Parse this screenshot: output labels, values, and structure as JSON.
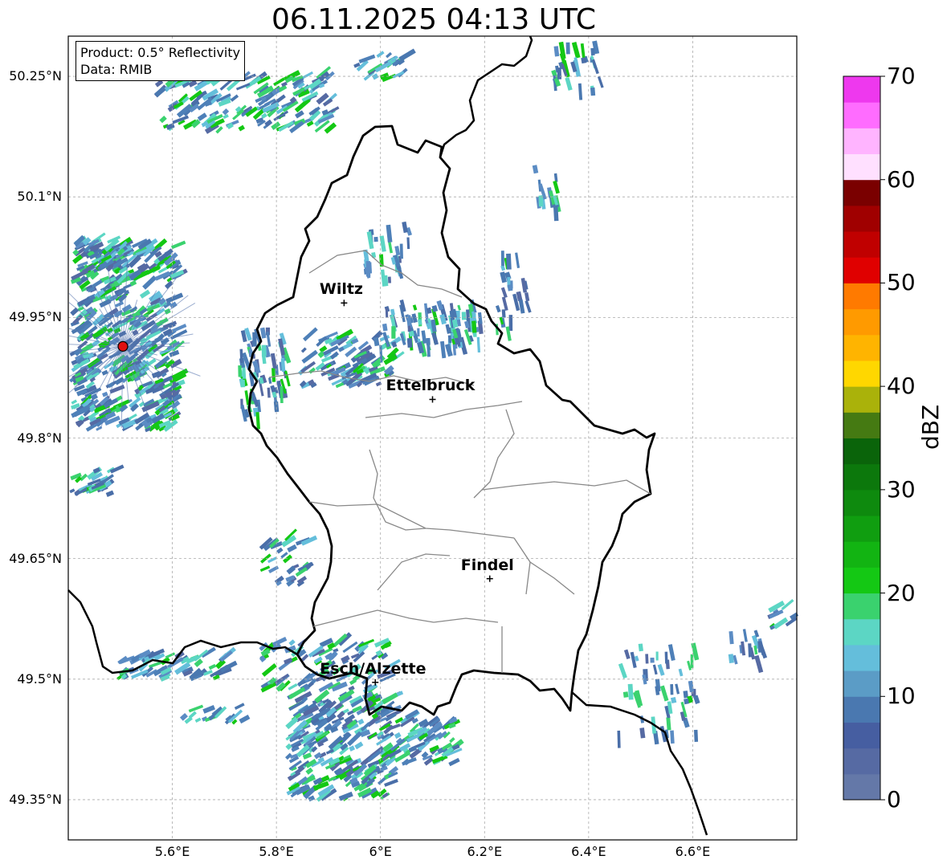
{
  "title": "06.11.2025 04:13 UTC",
  "info": {
    "product": "Product: 0.5° Reflectivity",
    "data": "Data: RMIB"
  },
  "axes": {
    "lat_labels": [
      "50.25°N",
      "50.1°N",
      "49.95°N",
      "49.8°N",
      "49.65°N",
      "49.5°N",
      "49.35°N"
    ],
    "lon_labels": [
      "5.6°E",
      "5.8°E",
      "6°E",
      "6.2°E",
      "6.4°E",
      "6.6°E"
    ],
    "lat_values": [
      50.25,
      50.1,
      49.95,
      49.8,
      49.65,
      49.5,
      49.35
    ],
    "lon_values": [
      5.6,
      5.8,
      6.0,
      6.2,
      6.4,
      6.6
    ],
    "lon_range": [
      5.4,
      6.8
    ],
    "lat_range": [
      49.3,
      50.3
    ]
  },
  "cities": [
    {
      "name": "Wiltz",
      "lon": 5.93,
      "lat": 49.968
    },
    {
      "name": "Ettelbruck",
      "lon": 6.1,
      "lat": 49.848
    },
    {
      "name": "Findel",
      "lon": 6.21,
      "lat": 49.625
    },
    {
      "name": "Esch/Alzette",
      "lon": 5.99,
      "lat": 49.496
    }
  ],
  "radar_site": {
    "lon": 5.505,
    "lat": 49.914
  },
  "colorbar": {
    "label": "dBZ",
    "ticks": [
      "0",
      "10",
      "20",
      "30",
      "40",
      "50",
      "60",
      "70"
    ],
    "colors": [
      "#6478a8",
      "#566aa3",
      "#465ea1",
      "#4a78b0",
      "#5b9cc6",
      "#64bedb",
      "#5cd6c4",
      "#3ad26e",
      "#14c814",
      "#12b412",
      "#109e10",
      "#0e8a0e",
      "#0c780c",
      "#0a640a",
      "#457a12",
      "#aab20a",
      "#ffd700",
      "#ffb400",
      "#ff9a00",
      "#ff7a00",
      "#e00000",
      "#c00000",
      "#a00000",
      "#7a0000",
      "#ffe0ff",
      "#ffb4ff",
      "#ff6cff",
      "#ee38ee"
    ]
  }
}
